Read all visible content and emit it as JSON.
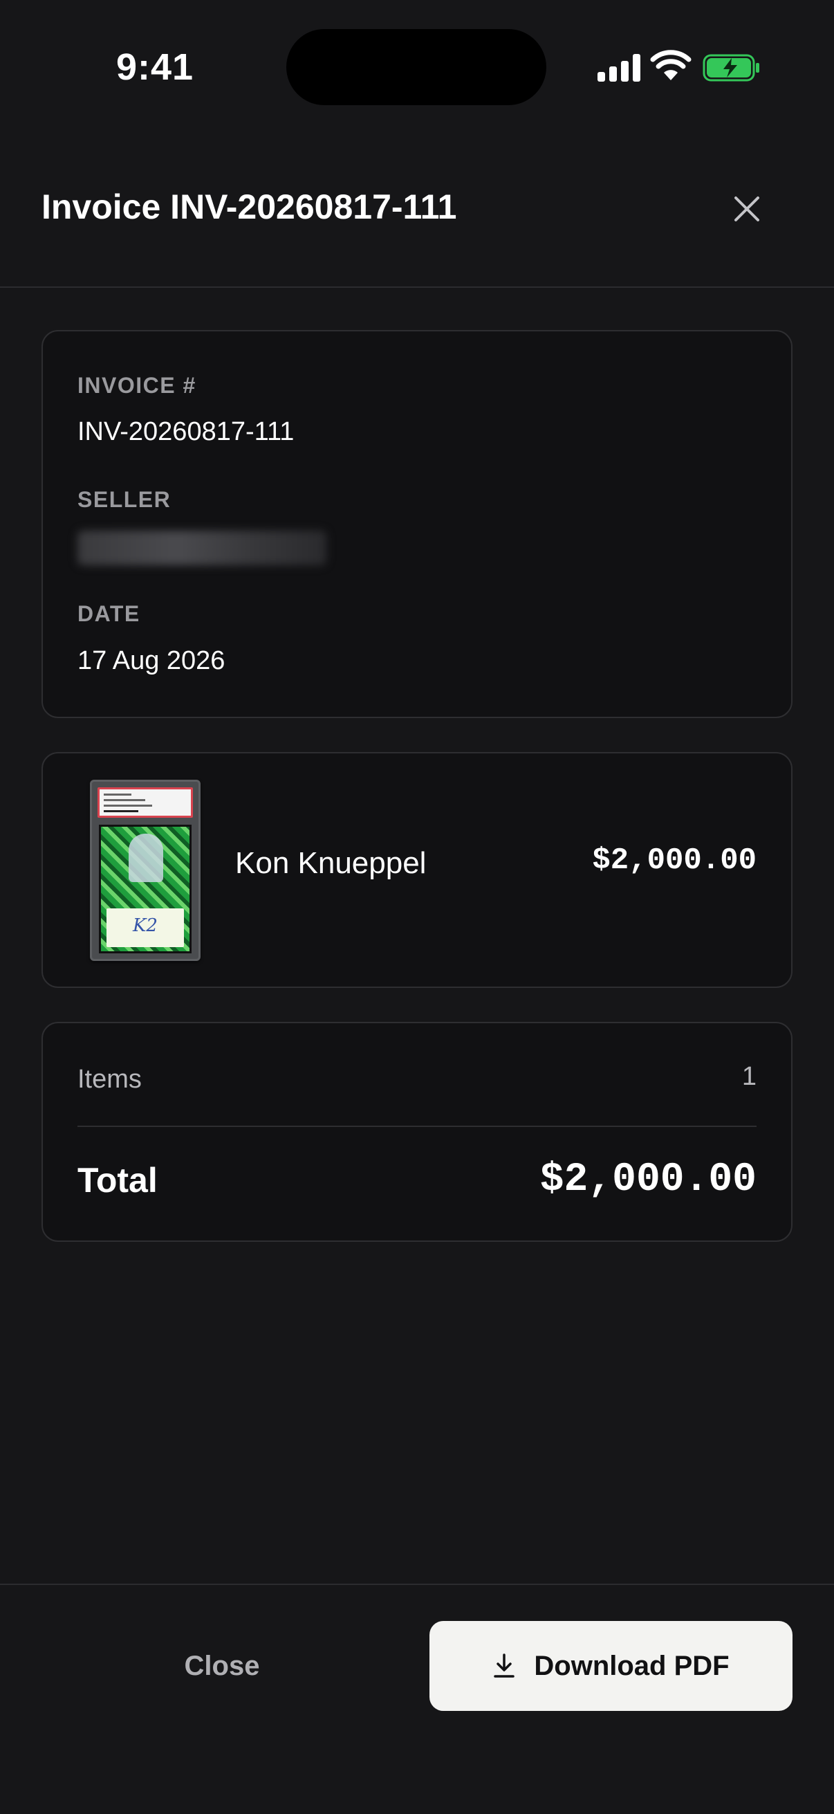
{
  "status_bar": {
    "time": "9:41"
  },
  "header": {
    "title": "Invoice INV-20260817-111",
    "close_icon": "close-icon"
  },
  "invoice_info": {
    "invoice_label": "INVOICE #",
    "invoice_value": "INV-20260817-111",
    "seller_label": "SELLER",
    "date_label": "DATE",
    "date_value": "17 Aug 2026"
  },
  "line_item": {
    "name": "Kon Knueppel",
    "price": "$2,000.00"
  },
  "summary": {
    "items_label": "Items",
    "items_count": "1",
    "total_label": "Total",
    "total_value": "$2,000.00"
  },
  "footer": {
    "close_label": "Close",
    "download_label": "Download PDF",
    "download_icon": "download-icon"
  },
  "colors": {
    "background": "#161618",
    "card": "#111113",
    "primary_button": "#f3f3f1",
    "battery_green": "#34c759"
  }
}
